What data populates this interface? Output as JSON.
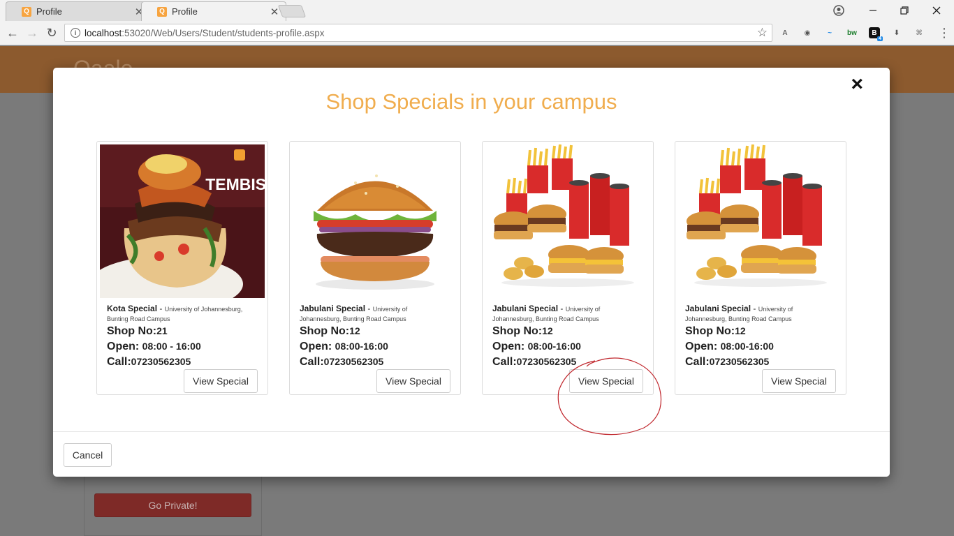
{
  "browser": {
    "tabs": [
      {
        "title": "Profile",
        "favicon": "Q"
      },
      {
        "title": "Profile",
        "favicon": "Q"
      }
    ],
    "url_host": "localhost",
    "url_path": ":53020/Web/Users/Student/students-profile.aspx",
    "extensions": [
      {
        "icon": "angular-icon",
        "label": "A",
        "color": "#666666"
      },
      {
        "icon": "globe-icon",
        "label": "◉",
        "color": "#555555"
      },
      {
        "icon": "wave-icon",
        "label": "~",
        "color": "#1e88e5"
      },
      {
        "icon": "bw-icon",
        "label": "bw",
        "color": "#1b7d2c"
      },
      {
        "icon": "b-icon",
        "label": "B",
        "color": "#111111",
        "badge": "4"
      },
      {
        "icon": "download-icon",
        "label": "⬇",
        "color": "#555555"
      },
      {
        "icon": "pdf-icon",
        "label": "⌘",
        "color": "#888888"
      }
    ]
  },
  "page": {
    "logo": "Qaalo",
    "go_private_label": "Go Private!"
  },
  "modal": {
    "title": "Shop Specials in your campus",
    "close": "×",
    "cancel_label": "Cancel",
    "cards": [
      {
        "shop": "Kota Special",
        "campus": "University of Johannesburg, Bunting Road Campus",
        "shop_no_label": "Shop No:",
        "shop_no": "21",
        "open_label": "Open:",
        "open": "08:00 - 16:00",
        "call_label": "Call:",
        "call": "07230562305",
        "button": "View Special",
        "image": "kota-sandwich",
        "image_text": "TEMBISA"
      },
      {
        "shop": "Jabulani Special",
        "campus": "University of Johannesburg, Bunting Road Campus",
        "shop_no_label": "Shop No:",
        "shop_no": "12",
        "open_label": "Open:",
        "open": "08:00-16:00",
        "call_label": "Call:",
        "call": "07230562305",
        "button": "View Special",
        "image": "burger"
      },
      {
        "shop": "Jabulani Special",
        "campus": "University of Johannesburg, Bunting Road Campus",
        "shop_no_label": "Shop No:",
        "shop_no": "12",
        "open_label": "Open:",
        "open": "08:00-16:00",
        "call_label": "Call:",
        "call": "07230562305",
        "button": "View Special",
        "image": "fast-food-combo"
      },
      {
        "shop": "Jabulani Special",
        "campus": "University of Johannesburg, Bunting Road Campus",
        "shop_no_label": "Shop No:",
        "shop_no": "12",
        "open_label": "Open:",
        "open": "08:00-16:00",
        "call_label": "Call:",
        "call": "07230562305",
        "button": "View Special",
        "image": "fast-food-combo"
      }
    ]
  },
  "colors": {
    "accent": "#f0ad4e",
    "danger": "#d9534f",
    "annotation": "#c0272d"
  }
}
